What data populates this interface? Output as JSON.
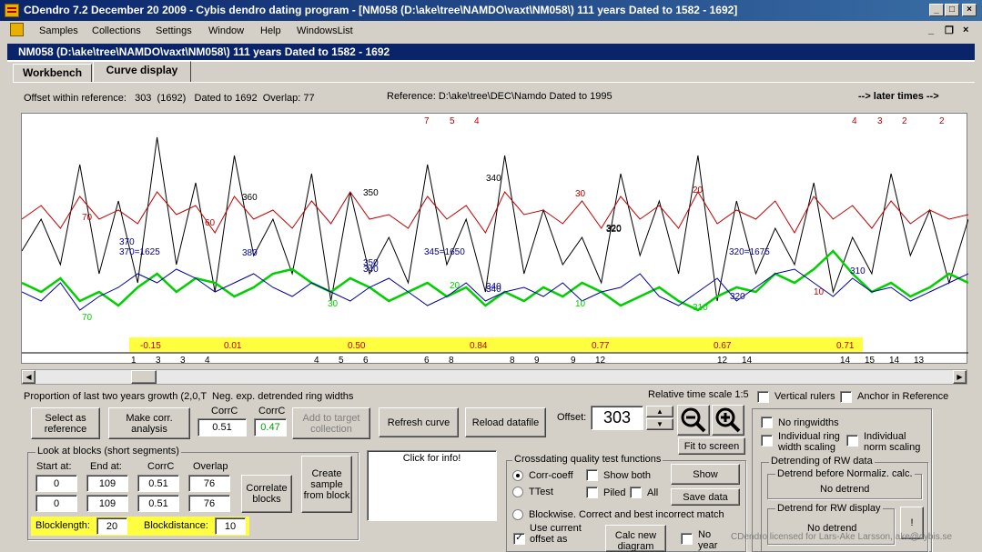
{
  "window": {
    "title": "CDendro 7.2  December 20 2009 - Cybis dendro dating program - [NM058    (D:\\ake\\tree\\NAMDO\\vaxt\\NM058\\)  111 years  Dated to 1582 - 1692]",
    "child_title": "NM058    (D:\\ake\\tree\\NAMDO\\vaxt\\NM058\\)  111 years  Dated to 1582 - 1692"
  },
  "menu": [
    "Samples",
    "Collections",
    "Settings",
    "Window",
    "Help",
    "WindowsList"
  ],
  "tabs": [
    "Workbench",
    "Curve display"
  ],
  "header": {
    "offset_info": "Offset within reference:   303  (1692)   Dated to 1692  Overlap: 77",
    "reference": "Reference: D:\\ake\\tree\\DEC\\Namdo  Dated to 1995",
    "later_times": "--> later times -->"
  },
  "chart_data": {
    "type": "line",
    "title": "",
    "top_labels": [
      "7",
      "5",
      "4",
      "4",
      "3",
      "2",
      "2"
    ],
    "ring_labels": [
      "370",
      "370=1625",
      "380",
      "350",
      "345=1650",
      "340",
      "320",
      "320=1675",
      "310",
      "70",
      "60",
      "360",
      "350",
      "340",
      "320",
      "30",
      "20",
      "10",
      "70",
      "30",
      "20",
      "10",
      "310",
      "320",
      "340",
      "340"
    ],
    "correlations": [
      "-0.15",
      "0.01",
      "0.50",
      "0.84",
      "0.77",
      "0.67",
      "0.71"
    ],
    "tick_labels": [
      "1",
      "3",
      "3",
      "4",
      "4",
      "5",
      "6",
      "6",
      "8",
      "8",
      "9",
      "9",
      "12",
      "12",
      "14",
      "14",
      "15",
      "14",
      "13"
    ],
    "series": [
      {
        "color": "#000000",
        "values": [
          275,
          240,
          290,
          180,
          300,
          220,
          310,
          150,
          290,
          200,
          320,
          170,
          280,
          240,
          300,
          190,
          330,
          210,
          300,
          260,
          310,
          180,
          290,
          240,
          320,
          170,
          300,
          230,
          290,
          260,
          310,
          190,
          280,
          220,
          300,
          170,
          330,
          220,
          300,
          250,
          290,
          200,
          320,
          260,
          300,
          190,
          280,
          230,
          310,
          240
        ]
      },
      {
        "color": "#c00000",
        "values": [
          240,
          225,
          250,
          215,
          240,
          230,
          245,
          210,
          235,
          225,
          255,
          215,
          240,
          230,
          250,
          220,
          245,
          210,
          240,
          235,
          250,
          215,
          240,
          225,
          255,
          210,
          235,
          230,
          245,
          220,
          250,
          215,
          240,
          225,
          250,
          210,
          245,
          230,
          240,
          220,
          255,
          215,
          240,
          225,
          250,
          220,
          245,
          230,
          240,
          235
        ]
      },
      {
        "color": "#00d000",
        "values": [
          310,
          320,
          305,
          330,
          320,
          335,
          315,
          300,
          320,
          305,
          310,
          325,
          315,
          300,
          295,
          310,
          320,
          305,
          315,
          330,
          320,
          310,
          325,
          315,
          335,
          320,
          330,
          315,
          325,
          310,
          320,
          335,
          325,
          315,
          330,
          340,
          325,
          315,
          320,
          300,
          310,
          295,
          275,
          300,
          320,
          310,
          325,
          315,
          300,
          310
        ]
      },
      {
        "color": "#0000a0",
        "values": [
          320,
          330,
          310,
          340,
          325,
          315,
          300,
          310,
          295,
          305,
          320,
          310,
          300,
          315,
          325,
          310,
          320,
          330,
          315,
          305,
          320,
          335,
          325,
          310,
          330,
          320,
          315,
          325,
          310,
          330,
          320,
          315,
          300,
          325,
          335,
          320,
          305,
          330,
          315,
          300,
          295,
          310,
          325,
          305,
          320,
          315,
          330,
          320,
          310,
          300
        ]
      }
    ]
  },
  "controls": {
    "growth_label": "Proportion of last two years growth (2,0,T  Neg. exp. detrended ring widths",
    "time_scale": "Relative time scale 1:5",
    "vertical_rulers": "Vertical rulers",
    "anchor_ref": "Anchor in Reference",
    "select_ref": "Select as reference",
    "make_corr": "Make corr. analysis",
    "corrc_label1": "CorrC",
    "corrc_value1": "0.51",
    "corrc_label2": "CorrC",
    "corrc_value2": "0.47",
    "add_target": "Add to target collection",
    "refresh": "Refresh curve",
    "reload": "Reload datafile",
    "offset_label": "Offset:",
    "offset_value": "303",
    "fit_screen": "Fit to screen",
    "no_ringwidths": "No ringwidths",
    "individual_ring": "Individual ring width scaling",
    "individual_norm": "Individual norm scaling",
    "detrending_label": "Detrending of RW data",
    "detrend_before": "Detrend before Normaliz. calc.",
    "no_detrend1": "No detrend",
    "detrend_display": "Detrend for RW display",
    "no_detrend2": "No detrend",
    "exclaim": "!",
    "blocks_label": "Look at blocks (short segments)",
    "start_at": "Start at:",
    "end_at": "End at:",
    "corrc_col": "CorrC",
    "overlap_col": "Overlap",
    "row1": [
      "0",
      "109",
      "0.51",
      "76"
    ],
    "row2": [
      "0",
      "109",
      "0.51",
      "76"
    ],
    "correlate_blocks": "Correlate blocks",
    "create_sample": "Create sample from block",
    "blocklength_label": "Blocklength:",
    "blocklength": "20",
    "blockdistance_label": "Blockdistance:",
    "blockdistance": "10",
    "click_info": "Click for info!",
    "cq_label": "Crossdating quality test functions",
    "corr_coeff": "Corr-coeff",
    "show_both": "Show both",
    "show": "Show",
    "ttest": "TTest",
    "piled": "Piled",
    "all": "All",
    "save_data": "Save data",
    "blockwise": "Blockwise. Correct and best incorrect match",
    "use_current": "Use current offset as",
    "calc_new": "Calc new diagram",
    "no_year": "No year number",
    "license": "CDendro licensed for Lars-Ake Larsson, ake@cybis.se"
  }
}
